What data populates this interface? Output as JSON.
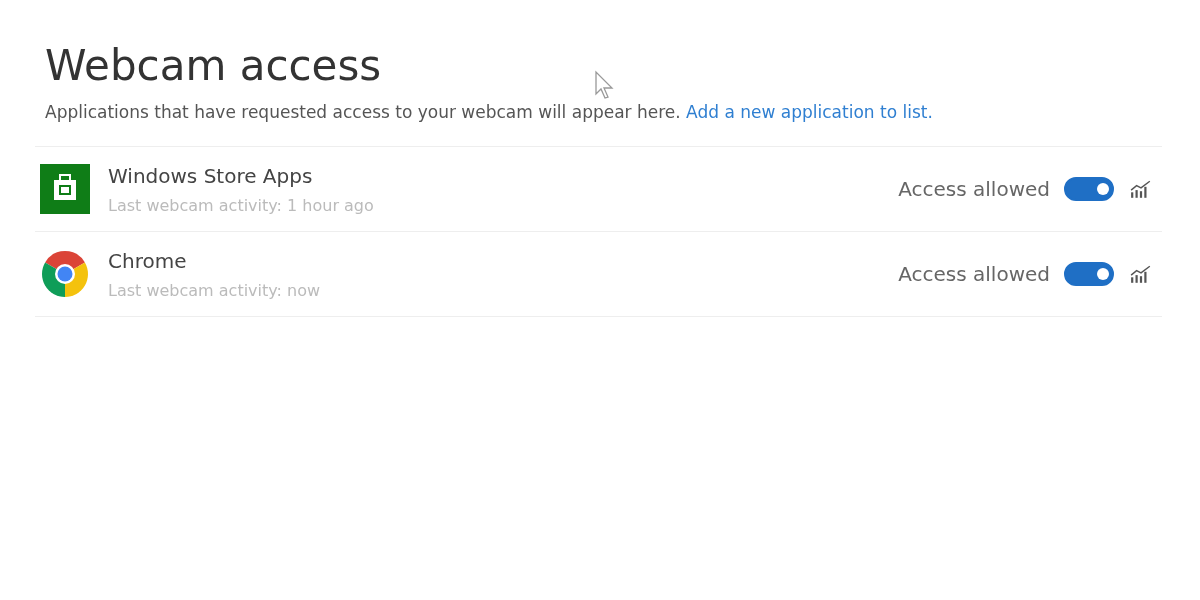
{
  "title": "Webcam access",
  "description": {
    "text": "Applications that have requested access to your webcam will appear here.",
    "link": "Add a new application to list."
  },
  "apps": [
    {
      "name": "Windows Store Apps",
      "kind": "store",
      "activity": "Last webcam activity: 1 hour ago",
      "status": "Access allowed",
      "on": true
    },
    {
      "name": "Chrome",
      "kind": "chrome",
      "activity": "Last webcam activity: now",
      "status": "Access allowed",
      "on": true
    }
  ]
}
